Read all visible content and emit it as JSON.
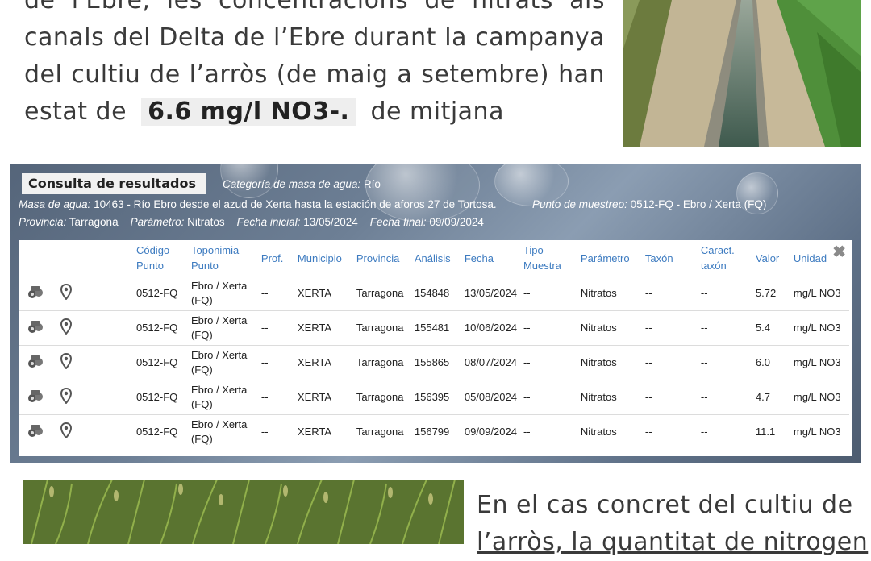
{
  "intro": {
    "line1": "de l'Ebre, les concentracions de nitrats als",
    "line2": "canals del Delta de l’Ebre durant la campanya",
    "line3": "del cultiu de l’arròs (de maig a setembre) han",
    "line4_before": "estat de",
    "highlight": "6.6 mg/l NO3-.",
    "line4_after": "de mitjana"
  },
  "panel": {
    "title": "Consulta de resultados",
    "categoria_label": "Categoría de masa de agua:",
    "categoria_value": " Río",
    "masa_label": "Masa de agua:",
    "masa_value": " 10463 - Río Ebro desde el azud de Xerta hasta la estación de aforos 27 de Tortosa.",
    "punto_label": "Punto de muestreo:",
    "punto_value": " 0512-FQ - Ebro / Xerta (FQ)",
    "provincia_label": "Provincia:",
    "provincia_value": " Tarragona",
    "parametro_label": "Parámetro:",
    "parametro_value": " Nitratos",
    "fecha_ini_label": "Fecha inicial:",
    "fecha_ini_value": " 13/05/2024",
    "fecha_fin_label": "Fecha final:",
    "fecha_fin_value": " 09/09/2024",
    "close_icon": "close-icon"
  },
  "table": {
    "headers": [
      "",
      "",
      "Código Punto",
      "Toponimia Punto",
      "Prof.",
      "Municipio",
      "Provincia",
      "Análisis",
      "Fecha",
      "Tipo Muestra",
      "Parámetro",
      "Taxón",
      "Caract. taxón",
      "Valor",
      "Unidad"
    ],
    "rows": [
      {
        "codigo": "0512-FQ",
        "toponimia": "Ebro / Xerta (FQ)",
        "prof": "--",
        "municipio": "XERTA",
        "provincia": "Tarragona",
        "analisis": "154848",
        "fecha": "13/05/2024",
        "tipo": "--",
        "parametro": "Nitratos",
        "taxon": "--",
        "caract": "--",
        "valor": "5.72",
        "unidad": "mg/L NO3"
      },
      {
        "codigo": "0512-FQ",
        "toponimia": "Ebro / Xerta (FQ)",
        "prof": "--",
        "municipio": "XERTA",
        "provincia": "Tarragona",
        "analisis": "155481",
        "fecha": "10/06/2024",
        "tipo": "--",
        "parametro": "Nitratos",
        "taxon": "--",
        "caract": "--",
        "valor": "5.4",
        "unidad": "mg/L NO3"
      },
      {
        "codigo": "0512-FQ",
        "toponimia": "Ebro / Xerta (FQ)",
        "prof": "--",
        "municipio": "XERTA",
        "provincia": "Tarragona",
        "analisis": "155865",
        "fecha": "08/07/2024",
        "tipo": "--",
        "parametro": "Nitratos",
        "taxon": "--",
        "caract": "--",
        "valor": "6.0",
        "unidad": "mg/L NO3"
      },
      {
        "codigo": "0512-FQ",
        "toponimia": "Ebro / Xerta (FQ)",
        "prof": "--",
        "municipio": "XERTA",
        "provincia": "Tarragona",
        "analisis": "156395",
        "fecha": "05/08/2024",
        "tipo": "--",
        "parametro": "Nitratos",
        "taxon": "--",
        "caract": "--",
        "valor": "4.7",
        "unidad": "mg/L NO3"
      },
      {
        "codigo": "0512-FQ",
        "toponimia": "Ebro / Xerta (FQ)",
        "prof": "--",
        "municipio": "XERTA",
        "provincia": "Tarragona",
        "analisis": "156799",
        "fecha": "09/09/2024",
        "tipo": "--",
        "parametro": "Nitratos",
        "taxon": "--",
        "caract": "--",
        "valor": "11.1",
        "unidad": "mg/L NO3"
      }
    ],
    "row_icons": [
      "binoculars-icon",
      "map-pin-icon"
    ]
  },
  "outro": {
    "line1": "En el cas concret del cultiu de",
    "line2": "l’arròs, la quantitat de nitrogen"
  },
  "colors": {
    "header_text": "#3d7bc0",
    "highlight_bg": "#eeeeee",
    "panel_bg": "#5f7188"
  }
}
